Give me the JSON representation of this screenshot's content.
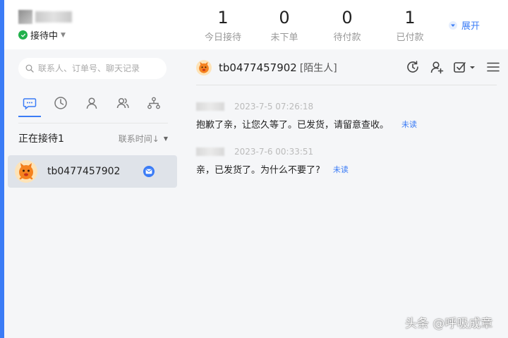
{
  "header": {
    "status": "接待中",
    "stats": [
      {
        "value": "1",
        "label": "今日接待"
      },
      {
        "value": "0",
        "label": "未下单"
      },
      {
        "value": "0",
        "label": "待付款"
      },
      {
        "value": "1",
        "label": "已付款"
      }
    ],
    "expand_label": "展开"
  },
  "sidebar": {
    "search_placeholder": "联系人、订单号、聊天记录",
    "tabs": [
      {
        "icon": "chat-bubble-icon",
        "active": true
      },
      {
        "icon": "clock-icon",
        "active": false
      },
      {
        "icon": "person-icon",
        "active": false
      },
      {
        "icon": "group-icon",
        "active": false
      },
      {
        "icon": "org-structure-icon",
        "active": false
      }
    ],
    "section_title": "正在接待1",
    "sort_label": "联系时间↓",
    "contacts": [
      {
        "name": "tb0477457902",
        "has_unread_mail": true
      }
    ]
  },
  "chat": {
    "title": "tb0477457902",
    "tag": "[陌生人]",
    "tools": [
      "history-icon",
      "add-user-icon",
      "checkbox-icon",
      "menu-icon"
    ],
    "messages": [
      {
        "time": "2023-7-5 07:26:18",
        "text": "抱歉了亲，让您久等了。已发货，请留意查收。",
        "status": "未读"
      },
      {
        "time": "2023-7-6 00:33:51",
        "text": "亲，已发货了。为什么不要了?",
        "status": "未读"
      }
    ]
  },
  "watermark": "头条 @呼吸成章",
  "colors": {
    "accent": "#3b7cf6",
    "online": "#22b14c",
    "panel_bg": "#f5f6f8",
    "selected_bg": "#dfe3e9"
  }
}
